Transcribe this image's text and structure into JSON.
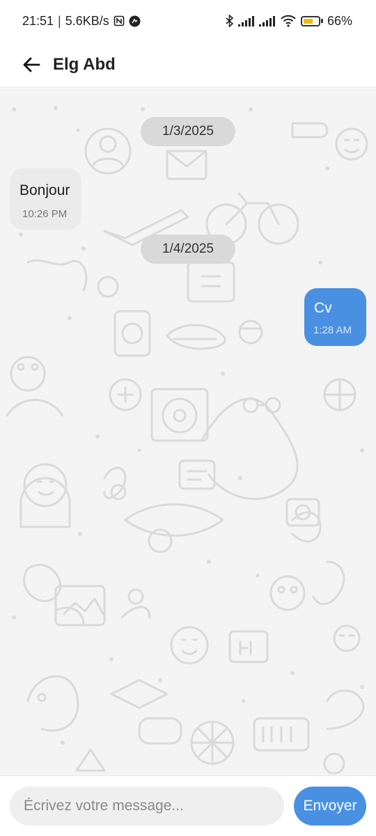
{
  "status_bar": {
    "time": "21:51",
    "separator": "|",
    "network_speed": "5.6KB/s",
    "battery_percent": "66%",
    "battery_level": 0.66,
    "battery_color": "#f2b705",
    "icons": [
      "nfc-icon",
      "app-notification-icon",
      "bluetooth-icon",
      "signal-icon",
      "signal-icon",
      "wifi-icon",
      "battery-icon"
    ]
  },
  "header": {
    "back_icon": "arrow-left-icon",
    "title": "Elg Abd"
  },
  "chat": {
    "items": [
      {
        "type": "date",
        "text": "1/3/2025"
      },
      {
        "type": "message",
        "direction": "incoming",
        "text": "Bonjour",
        "time": "10:26 PM"
      },
      {
        "type": "date",
        "text": "1/4/2025"
      },
      {
        "type": "message",
        "direction": "outgoing",
        "text": "Cv",
        "time": "1:28 AM"
      }
    ]
  },
  "composer": {
    "placeholder": "Écrivez votre message...",
    "value": "",
    "send_label": "Envoyer"
  },
  "colors": {
    "accent": "#4a90e2",
    "incoming_bubble": "#ebebeb",
    "date_chip": "#d9d9d9",
    "wallpaper": "#f4f4f4"
  }
}
